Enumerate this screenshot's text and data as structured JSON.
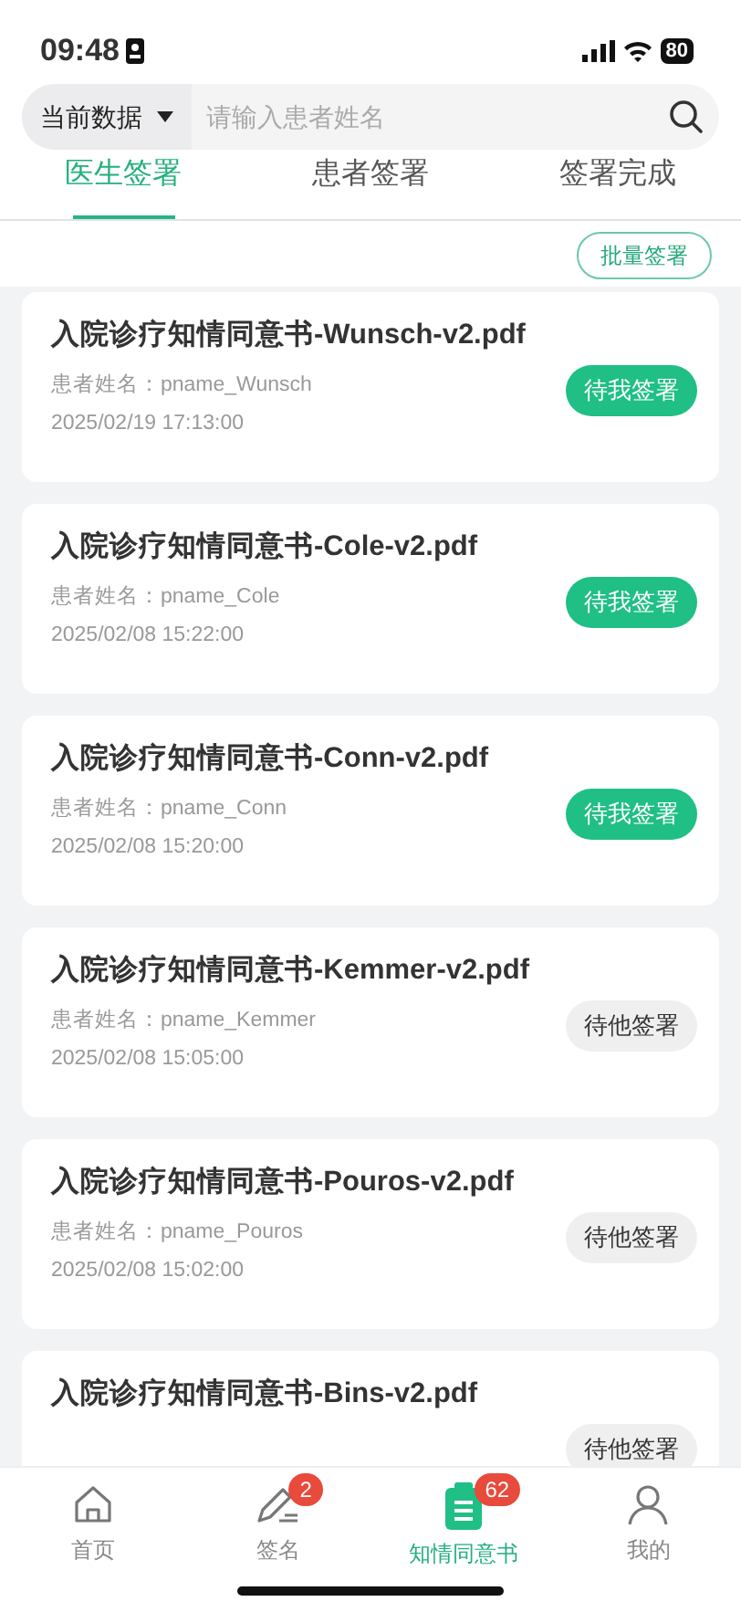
{
  "status_bar": {
    "time": "09:48",
    "battery": "80"
  },
  "search": {
    "scope": "当前数据",
    "placeholder": "请输入患者姓名"
  },
  "tabs": [
    {
      "label": "医生签署",
      "selected": true
    },
    {
      "label": "患者签署",
      "selected": false
    },
    {
      "label": "签署完成",
      "selected": false
    }
  ],
  "batch_button": "批量签署",
  "documents": [
    {
      "title": "入院诊疗知情同意书-Wunsch-v2.pdf",
      "patient": "患者姓名：pname_Wunsch",
      "time": "2025/02/19 17:13:00",
      "status": "待我签署",
      "kind": "mine"
    },
    {
      "title": "入院诊疗知情同意书-Cole-v2.pdf",
      "patient": "患者姓名：pname_Cole",
      "time": "2025/02/08 15:22:00",
      "status": "待我签署",
      "kind": "mine"
    },
    {
      "title": "入院诊疗知情同意书-Conn-v2.pdf",
      "patient": "患者姓名：pname_Conn",
      "time": "2025/02/08 15:20:00",
      "status": "待我签署",
      "kind": "mine"
    },
    {
      "title": "入院诊疗知情同意书-Kemmer-v2.pdf",
      "patient": "患者姓名：pname_Kemmer",
      "time": "2025/02/08 15:05:00",
      "status": "待他签署",
      "kind": "other"
    },
    {
      "title": "入院诊疗知情同意书-Pouros-v2.pdf",
      "patient": "患者姓名：pname_Pouros",
      "time": "2025/02/08 15:02:00",
      "status": "待他签署",
      "kind": "other"
    },
    {
      "title": "入院诊疗知情同意书-Bins-v2.pdf",
      "status": "待他签署",
      "kind": "other"
    }
  ],
  "bottom_nav": [
    {
      "label": "首页",
      "kind": "home",
      "selected": false
    },
    {
      "label": "签名",
      "kind": "sign",
      "badge": "2",
      "selected": false
    },
    {
      "label": "知情同意书",
      "kind": "consent",
      "badge": "62",
      "selected": true
    },
    {
      "label": "我的",
      "kind": "profile",
      "selected": false
    }
  ]
}
